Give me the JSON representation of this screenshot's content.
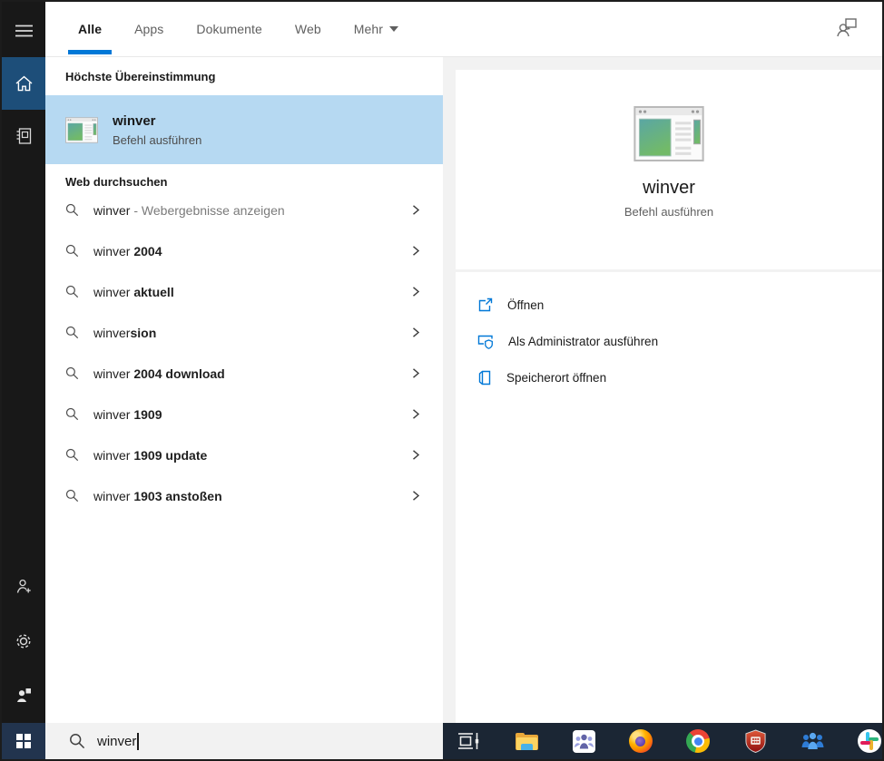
{
  "header": {
    "tabs": [
      {
        "label": "Alle",
        "active": true
      },
      {
        "label": "Apps",
        "active": false
      },
      {
        "label": "Dokumente",
        "active": false
      },
      {
        "label": "Web",
        "active": false
      }
    ],
    "more_label": "Mehr"
  },
  "sidebar": {
    "icons": [
      "menu",
      "home",
      "notebook",
      "add-account",
      "settings",
      "feedback"
    ]
  },
  "best_match": {
    "section_title": "Höchste Übereinstimmung",
    "title": "winver",
    "subtitle": "Befehl ausführen"
  },
  "web_search": {
    "section_title": "Web durchsuchen",
    "suggestions": [
      {
        "pre": "winver",
        "bold": "",
        "muted": " - Webergebnisse anzeigen"
      },
      {
        "pre": "winver ",
        "bold": "2004",
        "muted": ""
      },
      {
        "pre": "winver ",
        "bold": "aktuell",
        "muted": ""
      },
      {
        "pre": "winver",
        "bold": "sion",
        "muted": ""
      },
      {
        "pre": "winver ",
        "bold": "2004 download",
        "muted": ""
      },
      {
        "pre": "winver ",
        "bold": "1909",
        "muted": ""
      },
      {
        "pre": "winver ",
        "bold": "1909 update",
        "muted": ""
      },
      {
        "pre": "winver ",
        "bold": "1903 anstoßen",
        "muted": ""
      }
    ]
  },
  "preview": {
    "title": "winver",
    "subtitle": "Befehl ausführen",
    "actions": [
      {
        "label": "Öffnen",
        "icon": "open-icon"
      },
      {
        "label": "Als Administrator ausführen",
        "icon": "run-as-admin-icon"
      },
      {
        "label": "Speicherort öffnen",
        "icon": "open-file-location-icon"
      }
    ]
  },
  "search_box": {
    "value": "winver",
    "placeholder": ""
  },
  "taskbar": {
    "icons": [
      "task-view",
      "file-explorer",
      "teams",
      "firefox",
      "chrome",
      "security-shield",
      "contacts",
      "slack"
    ]
  },
  "colors": {
    "accent": "#0078d7",
    "selection": "#b6d9f2",
    "rail": "#181818",
    "rail_active": "#1d4e79",
    "taskbar": "#1b2634"
  }
}
